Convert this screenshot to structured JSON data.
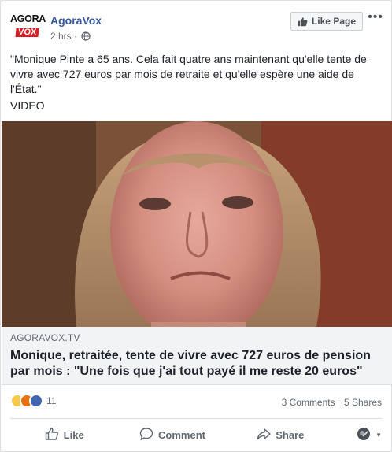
{
  "post": {
    "page_name": "AgoraVox",
    "logo": {
      "line1": "AGORA",
      "line2": "VOX"
    },
    "timestamp": "2 hrs",
    "separator": "·",
    "like_page_label": "Like Page",
    "more_label": "•••",
    "text": "\"Monique Pinte a 65 ans. Cela fait quatre ans maintenant qu'elle tente de vivre avec 727 euros par mois de retraite et qu'elle espère une aide de l'État.\"",
    "video_label": "VIDEO"
  },
  "link": {
    "domain": "AGORAVOX.TV",
    "title": "Monique, retraitée, tente de vivre avec 727 euros de pension par mois : \"Une fois que j'ai tout payé il me reste 20 euros\""
  },
  "stats": {
    "reaction_count": "11",
    "comments": "3 Comments",
    "shares": "5 Shares"
  },
  "actions": {
    "like": "Like",
    "comment": "Comment",
    "share": "Share"
  },
  "colors": {
    "link_blue": "#365899",
    "logo_red": "#d81f26",
    "like_blue": "#4267b2"
  }
}
